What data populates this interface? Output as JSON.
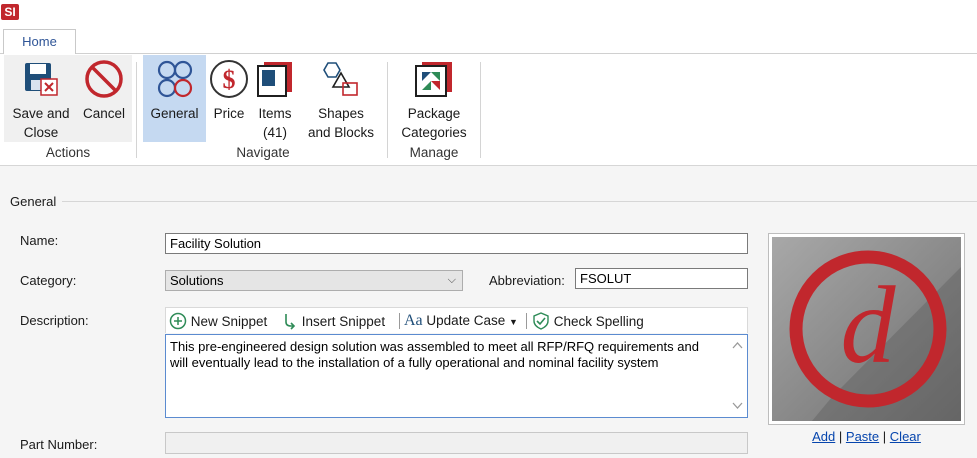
{
  "app": {
    "logo_text": "SI"
  },
  "tabs": [
    {
      "label": "Home"
    }
  ],
  "ribbon": {
    "groups": {
      "actions": {
        "label": "Actions"
      },
      "navigate": {
        "label": "Navigate"
      },
      "manage": {
        "label": "Manage"
      }
    },
    "buttons": {
      "save_close": {
        "line1": "Save and",
        "line2": "Close"
      },
      "cancel": {
        "line1": "Cancel"
      },
      "general": {
        "line1": "General"
      },
      "price": {
        "line1": "Price"
      },
      "items": {
        "line1": "Items",
        "line2": "(41)"
      },
      "shapes": {
        "line1": "Shapes",
        "line2": "and Blocks"
      },
      "package": {
        "line1": "Package",
        "line2": "Categories"
      }
    }
  },
  "form": {
    "section_title": "General",
    "name": {
      "label": "Name:",
      "value": "Facility Solution"
    },
    "category": {
      "label": "Category:",
      "value": "Solutions"
    },
    "abbreviation": {
      "label": "Abbreviation:",
      "value": "FSOLUT"
    },
    "description": {
      "label": "Description:",
      "toolbar": {
        "new_snippet": "New Snippet",
        "insert_snippet": "Insert Snippet",
        "update_case": "Update Case",
        "check_spelling": "Check Spelling"
      },
      "value": "This pre-engineered design solution was assembled to meet all RFP/RFQ requirements and will eventually lead to the installation of a fully operational and nominal facility system"
    },
    "part_number": {
      "label": "Part Number:",
      "value": ""
    }
  },
  "image_panel": {
    "add": "Add",
    "paste": "Paste",
    "clear": "Clear",
    "separator": "|"
  },
  "colors": {
    "accent_red": "#c1272d",
    "selected_blue": "#c5d9f1",
    "link_blue": "#0645ad",
    "tab_text": "#2f5597"
  },
  "icons": [
    "save-close-icon",
    "cancel-icon",
    "general-icon",
    "price-icon",
    "items-icon",
    "shapes-icon",
    "package-categories-icon",
    "plus-circle-icon",
    "insert-arrow-icon",
    "update-case-icon",
    "check-spelling-icon",
    "chevron-down-icon"
  ]
}
